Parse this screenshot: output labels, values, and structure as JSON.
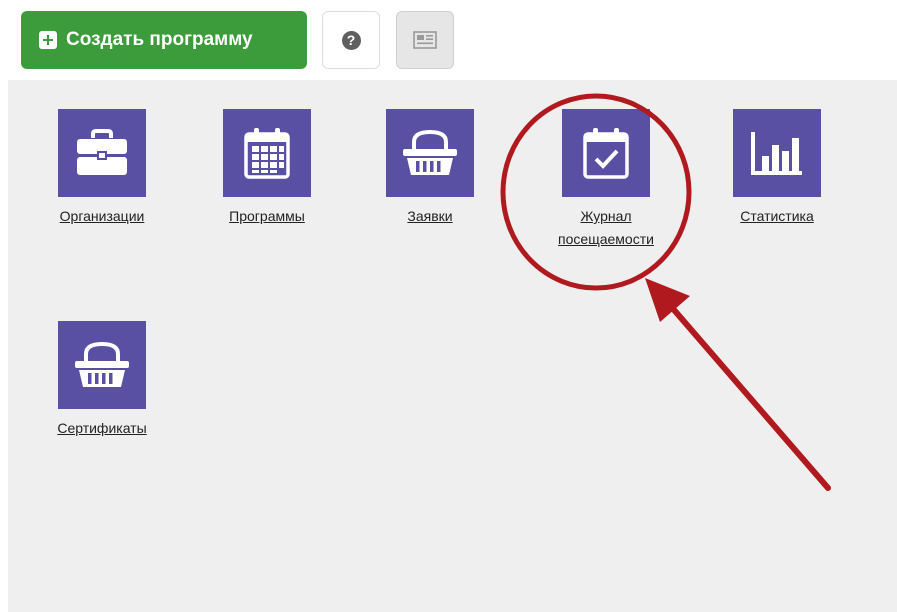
{
  "toolbar": {
    "create_label": "Создать программу",
    "help_glyph": "?",
    "plus_icon": "plus-square-icon",
    "help_icon": "question-circle-icon",
    "news_icon": "newspaper-icon"
  },
  "tiles": [
    {
      "label": "Организации",
      "icon": "briefcase-icon"
    },
    {
      "label": "Программы",
      "icon": "calendar-grid-icon"
    },
    {
      "label": "Заявки",
      "icon": "basket-icon"
    },
    {
      "label_line1": "Журнал",
      "label_line2": "посещаемости",
      "icon": "calendar-check-icon"
    },
    {
      "label": "Статистика",
      "icon": "bar-chart-icon"
    },
    {
      "label": "Сертификаты",
      "icon": "basket-icon"
    }
  ],
  "colors": {
    "create_button": "#3c9b3a",
    "tile_icon_bg": "#5a50a3",
    "panel_bg": "#efefef",
    "annotation_red": "#b01a1f"
  }
}
